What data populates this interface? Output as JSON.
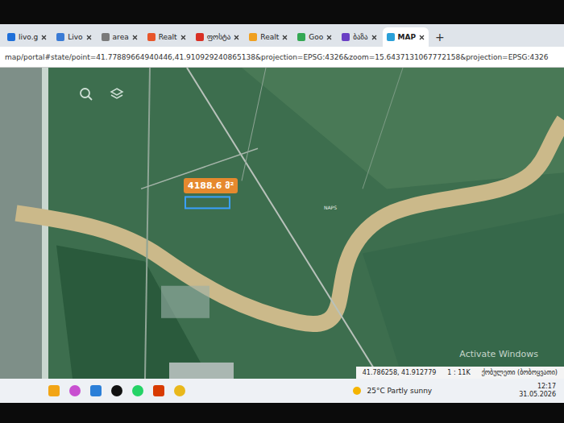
{
  "browser": {
    "tabs": [
      {
        "label": "livo.g",
        "selected": false,
        "color": "#1e6fd9"
      },
      {
        "label": "Livo",
        "selected": false,
        "color": "#3a7bd5"
      },
      {
        "label": "area",
        "selected": false,
        "color": "#7a7a7a"
      },
      {
        "label": "Realt",
        "selected": false,
        "color": "#e8562a"
      },
      {
        "label": "ფოსტა",
        "selected": false,
        "color": "#d93025"
      },
      {
        "label": "Realt",
        "selected": false,
        "color": "#f0a020"
      },
      {
        "label": "Goo",
        "selected": false,
        "color": "#34a853"
      },
      {
        "label": "ბაზა",
        "selected": false,
        "color": "#6a3fc4"
      },
      {
        "label": "MAP",
        "selected": true,
        "color": "#2aa0d8"
      }
    ],
    "new_tab": "+",
    "address": "map/portal#state/point=41.77889664940446,41.910929240865138&projection=EPSG:4326&zoom=15.6437131067772158&projection=EPSG:4326"
  },
  "map": {
    "area_badge": "4188.6 მ²",
    "place_label": "NAPS",
    "coordinates": "41.786258, 41.912779",
    "scale": "1 : 11K",
    "municipality": "ქობულეთი (ბობოყვათი)"
  },
  "watermark": "Activate Windows",
  "taskbar": {
    "weather": "25°C Partly sunny",
    "time": "12:17",
    "date": "31.05.2026"
  }
}
